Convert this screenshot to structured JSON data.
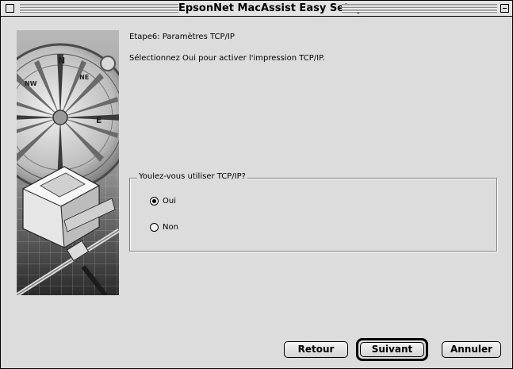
{
  "window": {
    "title": "EpsonNet MacAssist Easy Setup"
  },
  "step": {
    "title": "Etape6: Paramètres TCP/IP",
    "instruction": "Sélectionnez Oui pour activer l'impression TCP/IP."
  },
  "tcpip_group": {
    "label": "Youlez-vous utiliser TCP/IP?",
    "options": [
      {
        "label": "Oui",
        "selected": true
      },
      {
        "label": "Non",
        "selected": false
      }
    ]
  },
  "buttons": {
    "back_label": "Retour",
    "next_label": "Suivant",
    "cancel_label": "Annuler",
    "default": "Suivant"
  },
  "side_image": {
    "subject": "compass and printer illustration"
  }
}
